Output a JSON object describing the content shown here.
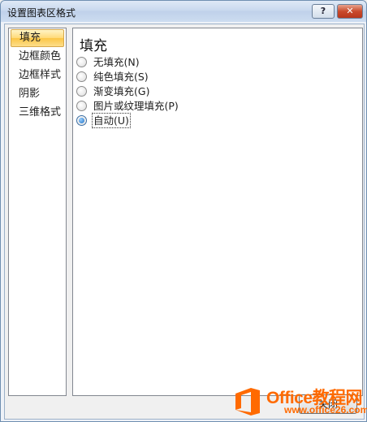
{
  "window": {
    "title": "设置图表区格式",
    "help_label": "?",
    "close_label": "✕"
  },
  "nav": {
    "items": [
      {
        "label": "填充",
        "selected": true
      },
      {
        "label": "边框颜色",
        "selected": false
      },
      {
        "label": "边框样式",
        "selected": false
      },
      {
        "label": "阴影",
        "selected": false
      },
      {
        "label": "三维格式",
        "selected": false
      }
    ]
  },
  "panel": {
    "title": "填充",
    "options": [
      {
        "label": "无填充(N)",
        "checked": false
      },
      {
        "label": "纯色填充(S)",
        "checked": false
      },
      {
        "label": "渐变填充(G)",
        "checked": false
      },
      {
        "label": "图片或纹理填充(P)",
        "checked": false
      },
      {
        "label": "自动(U)",
        "checked": true
      }
    ]
  },
  "footer": {
    "close_label": "关闭"
  },
  "watermark": {
    "line1": "Office教程网",
    "line2": "www.office26.com",
    "color": "#ff6a00"
  }
}
